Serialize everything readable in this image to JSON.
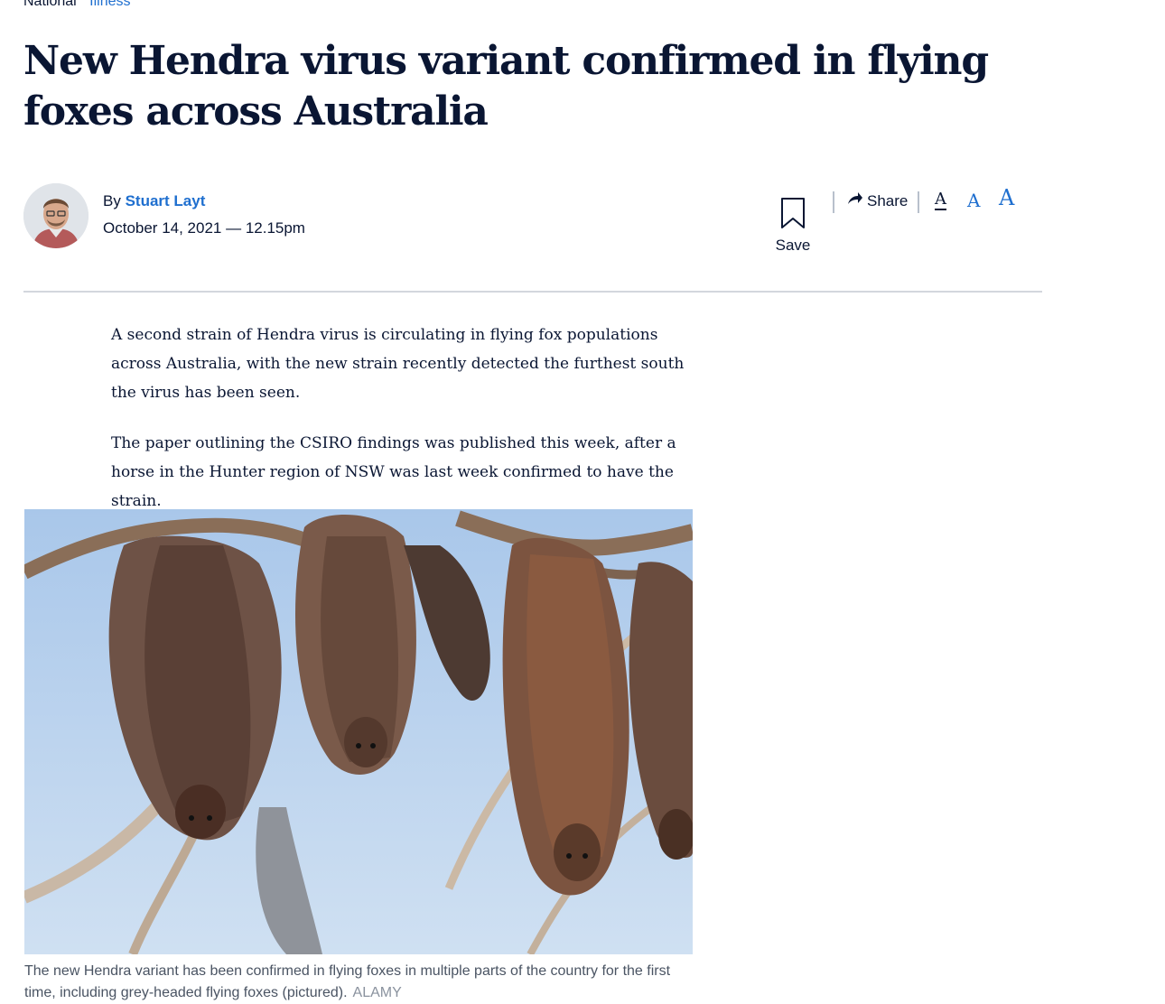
{
  "breadcrumb": {
    "section": "National",
    "subsection": "Illness"
  },
  "article": {
    "title": "New Hendra virus variant confirmed in flying foxes across Australia",
    "byline_prefix": "By",
    "author": "Stuart Layt",
    "date": "October 14, 2021 — 12.15pm",
    "paragraphs": [
      "A second strain of Hendra virus is circulating in flying fox populations across Australia, with the new strain recently detected the furthest south the virus has been seen.",
      "The paper outlining the CSIRO findings was published this week, after a horse in the Hunter region of NSW was last week confirmed to have the strain."
    ],
    "image_caption": "The new Hendra variant has been confirmed in flying foxes in multiple parts of the country for the first time, including grey-headed flying foxes (pictured).",
    "image_credit": "ALAMY"
  },
  "toolbar": {
    "save_label": "Save",
    "share_label": "Share",
    "font_small": "A",
    "font_medium": "A",
    "font_large": "A"
  },
  "icons": [
    "bookmark-icon",
    "share-arrow-icon"
  ],
  "colors": {
    "text": "#0a1633",
    "link": "#1f6fcf",
    "sky": "#b9d3ee"
  }
}
